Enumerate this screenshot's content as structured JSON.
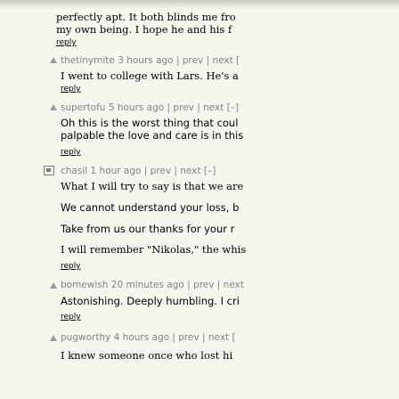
{
  "top": {
    "line1": "perfectly apt. It both blinds me fro",
    "line2": "my own being. I hope he and his f",
    "reply": "reply"
  },
  "comments": [
    {
      "user": "thetinymite",
      "meta": "3 hours ago | prev | next [",
      "lines": [
        "I went to college with Lars. He's a"
      ],
      "reply": "reply"
    },
    {
      "user": "supertofu",
      "meta": "5 hours ago | prev | next [–]",
      "lines": [
        "Oh this is the worst thing that coul",
        "palpable the love and care is in this"
      ],
      "reply": "reply"
    },
    {
      "user": "chasil",
      "meta": "1 hour ago | prev | next [–]",
      "lines": [
        "What I will try to say is that we are",
        "We cannot understand your loss, b",
        "Take from us our thanks for your r",
        "I will remember \"Nikolas,\" the whis"
      ],
      "reply": "reply"
    },
    {
      "user": "bomewish",
      "meta": "20 minutes ago | prev | next",
      "lines": [
        "Astonishing. Deeply humbling. I cri"
      ],
      "reply": "reply"
    },
    {
      "user": "pugworthy",
      "meta": "4 hours ago | prev | next [",
      "lines": [
        "I knew someone once who lost hi"
      ],
      "reply": "reply"
    }
  ]
}
